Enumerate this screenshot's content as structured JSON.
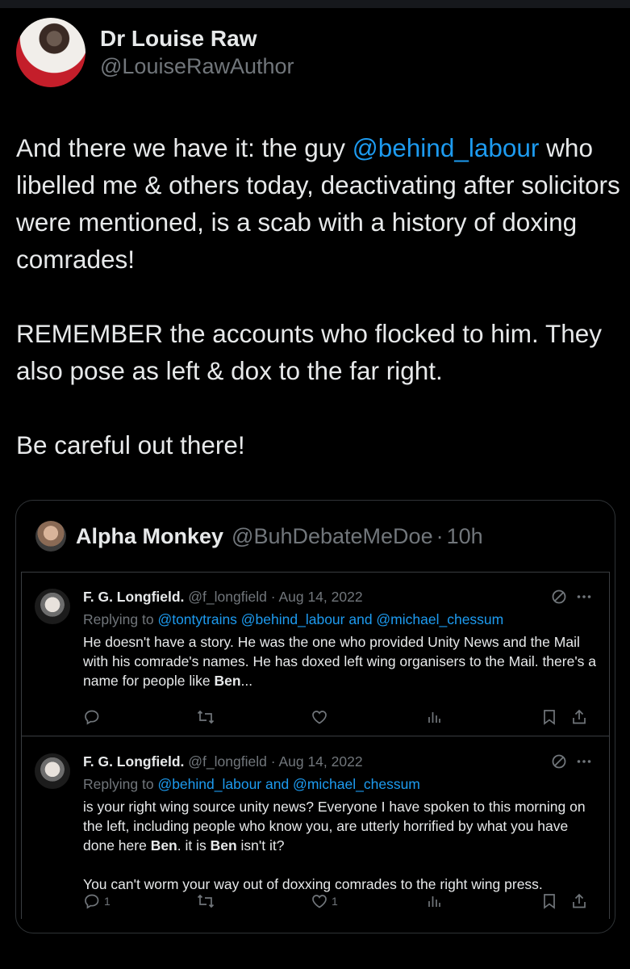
{
  "author": {
    "name": "Dr Louise Raw",
    "handle": "@LouiseRawAuthor"
  },
  "tweet": {
    "p1_before": "And there we have it: the guy ",
    "p1_mention": "@behind_labour",
    "p1_after": " who libelled me & others today, deactivating after solicitors were mentioned, is a scab with a history of doxing comrades!",
    "p2": "REMEMBER the accounts who flocked to him. They also pose as left & dox to the far right.",
    "p3": "Be careful out there!"
  },
  "quote": {
    "name": "Alpha Monkey",
    "handle": "@BuhDebateMeDoe",
    "separator": "·",
    "time": "10h"
  },
  "replies": [
    {
      "name": "F. G. Longfield.",
      "handle": "@f_longfield",
      "separator": "·",
      "date": "Aug 14, 2022",
      "replying_label": "Replying to",
      "replying_to": "@tontytrains @behind_labour and @michael_chessum",
      "text_1": "He doesn't have a story. He was the one who provided Unity News and the Mail with his comrade's names. He has doxed left wing organisers to the Mail. there's a name for people like ",
      "bold_1": "Ben",
      "text_1_end": "...",
      "reply_count": "",
      "like_count": ""
    },
    {
      "name": "F. G. Longfield.",
      "handle": "@f_longfield",
      "separator": "·",
      "date": "Aug 14, 2022",
      "replying_label": "Replying to",
      "replying_to": "@behind_labour and @michael_chessum",
      "text_1": "is your right wing source unity news? Everyone I have spoken to this morning on the left, including people who know you, are utterly horrified by what you have done here ",
      "bold_1": "Ben",
      "text_mid": ".  it is ",
      "bold_2": "Ben",
      "text_1_end": " isn't it?",
      "text_2": "You can't worm your way out of doxxing comrades to the right wing press.",
      "reply_count": "1",
      "like_count": "1"
    }
  ],
  "icons": [
    "no-sign-icon",
    "more-icon",
    "reply-icon",
    "retweet-icon",
    "like-icon",
    "analytics-icon",
    "bookmark-icon",
    "share-icon"
  ],
  "colors": {
    "accent": "#1d9bf0",
    "text": "#e7e9ea",
    "muted": "#71767b",
    "background": "#000000",
    "border": "#2f3336"
  }
}
